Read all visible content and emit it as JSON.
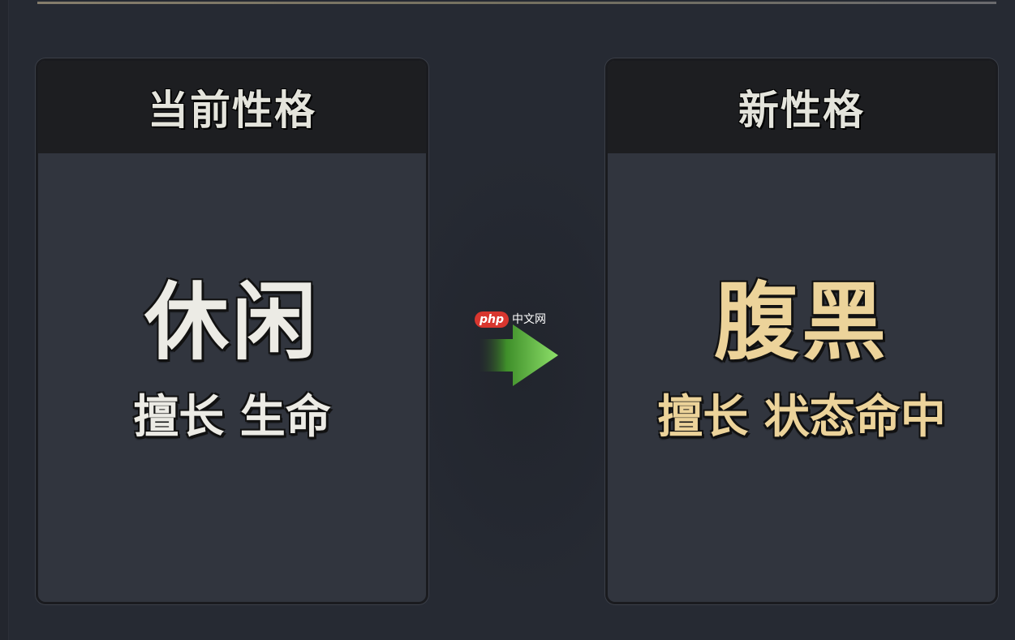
{
  "current_card": {
    "header": "当前性格",
    "trait_name": "休闲",
    "trait_desc": "擅长 生命"
  },
  "new_card": {
    "header": "新性格",
    "trait_name": "腹黑",
    "trait_desc": "擅长 状态命中"
  },
  "watermark": {
    "badge": "php",
    "text": "中文网"
  },
  "colors": {
    "background": "#262a33",
    "card_body": "#31353e",
    "card_header": "#1d1e21",
    "current_text": "#ecebe5",
    "new_text": "#ecd39a",
    "arrow_light": "#8ee06a",
    "arrow_dark": "#3f8f2a"
  }
}
